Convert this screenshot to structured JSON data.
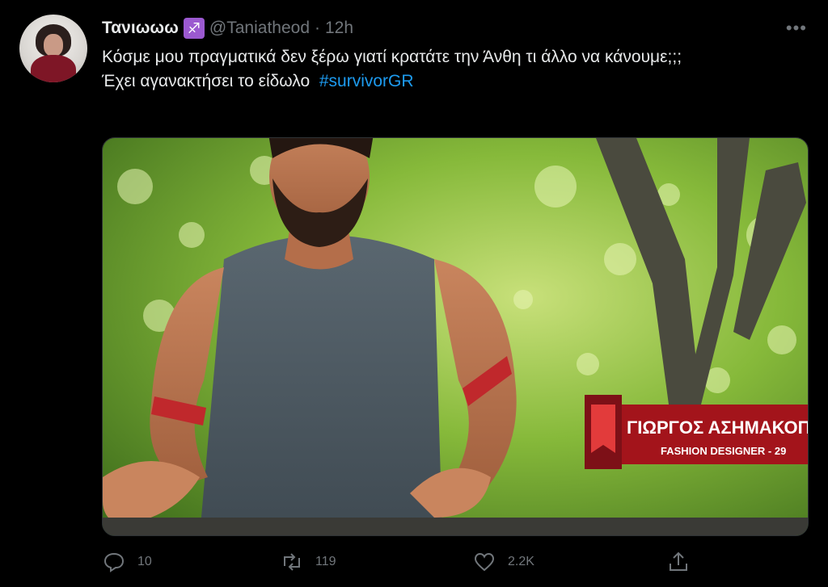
{
  "tweet": {
    "author_name": "Τανιωωω",
    "author_badge_icon": "sagittarius-icon",
    "handle": "@Taniatheod",
    "separator": "·",
    "time": "12h",
    "text_line1": "Κόσμε μου πραγματικά δεν ξέρω γιατί κρατάτε την Άνθη τι άλλο να κάνουμε;;;",
    "text_line2": "Έχει αγανακτήσει το είδωλο",
    "hashtag": "#survivorGR",
    "media": {
      "caption_name": "ΓΙΩΡΓΟΣ ΑΣΗΜΑΚΟΠΟ",
      "caption_subtitle": "FASHION DESIGNER - 29"
    },
    "stats": {
      "replies": "10",
      "retweets": "119",
      "likes": "2.2K"
    }
  },
  "colors": {
    "background": "#000000",
    "text": "#e7e9ea",
    "muted": "#71767b",
    "hashtag": "#1d9bf0",
    "badge": "#9b59d0"
  }
}
